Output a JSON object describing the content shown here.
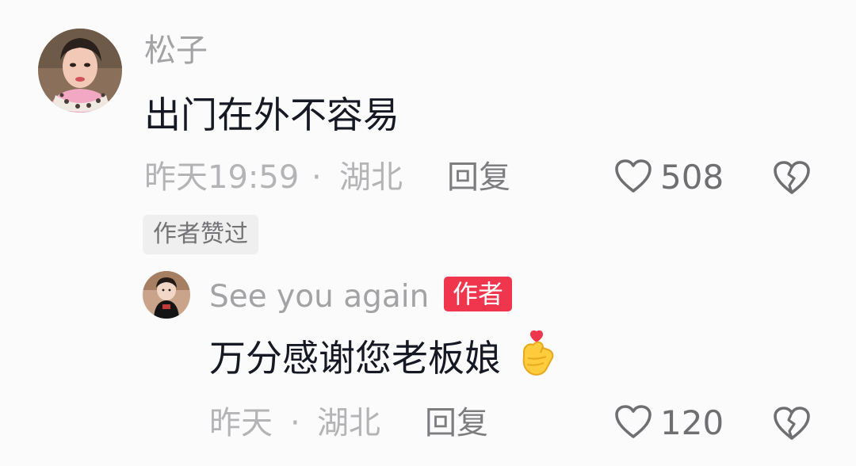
{
  "comments": [
    {
      "username": "松子",
      "content": "出门在外不容易",
      "time": "昨天19:59",
      "separator": "·",
      "location": "湖北",
      "reply_label": "回复",
      "like_count": "508",
      "author_liked_tag": "作者赞过",
      "replies": [
        {
          "username": "See you again",
          "author_badge": "作者",
          "content": "万分感谢您老板娘",
          "emoji": "finger-heart-emoji",
          "time": "昨天",
          "separator": "·",
          "location": "湖北",
          "reply_label": "回复",
          "like_count": "120"
        }
      ]
    }
  ],
  "icons": {
    "like": "heart-outline-icon",
    "dislike": "broken-heart-icon"
  },
  "colors": {
    "author_badge": "#f0364d",
    "text_primary": "#161823",
    "text_secondary": "#a3a3a5",
    "background": "#fbfbfb"
  }
}
